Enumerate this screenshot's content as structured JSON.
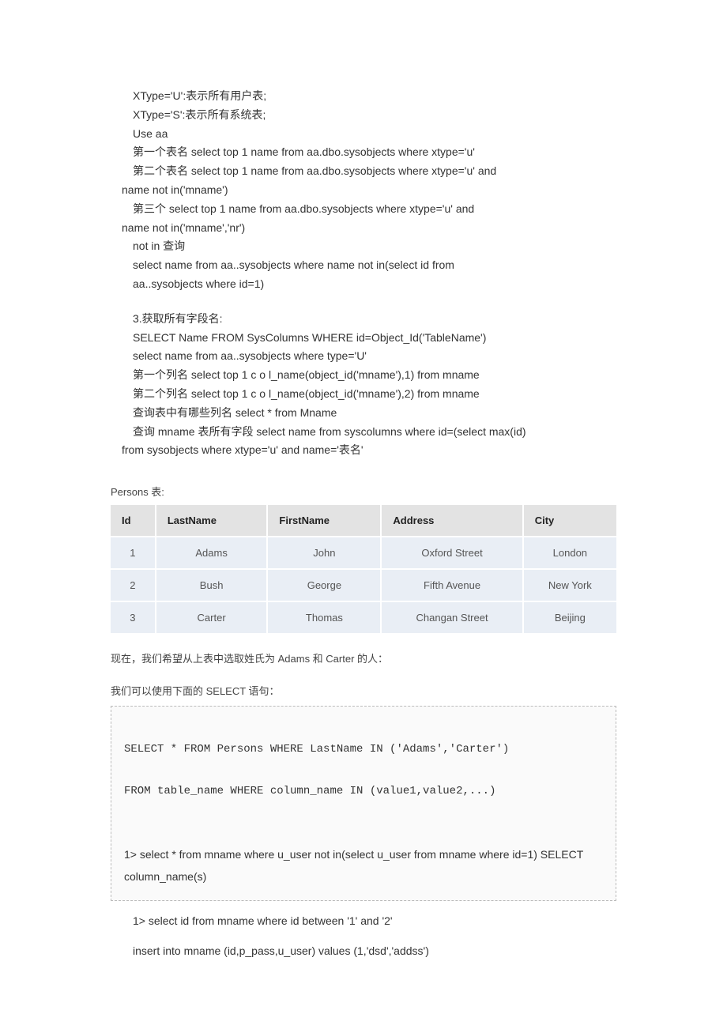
{
  "block1": {
    "l1": "XType='U':表示所有用户表;",
    "l2": "XType='S':表示所有系统表;",
    "l3": "Use aa",
    "l4": "第一个表名 select top 1 name from aa.dbo.sysobjects where xtype='u'",
    "l5a": "第二个表名 select top 1 name from aa.dbo.sysobjects where xtype='u' and",
    "l5b": "name not in('mname')",
    "l6a": "第三个 select top 1 name from aa.dbo.sysobjects where xtype='u' and",
    "l6b": "name not in('mname','nr')",
    "l7": "not in 查询",
    "l8": "select name from aa..sysobjects where name not in(select id from",
    "l9": "aa..sysobjects where id=1)"
  },
  "block2": {
    "l1": "3.获取所有字段名:",
    "l2": "SELECT Name FROM SysColumns WHERE id=Object_Id('TableName')",
    "l3": "select name from aa..sysobjects where type='U'",
    "l4": "第一个列名 select top 1   c o l_name(object_id('mname'),1) from mname",
    "l5": "第二个列名 select top 1   c o l_name(object_id('mname'),2) from mname",
    "l6": "查询表中有哪些列名 select * from Mname",
    "l7a": "查询 mname 表所有字段 select name from syscolumns where id=(select max(id)",
    "l7b": "from sysobjects where xtype='u' and name='表名'"
  },
  "caption": "Persons 表:",
  "table": {
    "headers": [
      "Id",
      "LastName",
      "FirstName",
      "Address",
      "City"
    ],
    "rows": [
      [
        "1",
        "Adams",
        "John",
        "Oxford Street",
        "London"
      ],
      [
        "2",
        "Bush",
        "George",
        "Fifth Avenue",
        "New York"
      ],
      [
        "3",
        "Carter",
        "Thomas",
        "Changan Street",
        "Beijing"
      ]
    ]
  },
  "note1": "现在，我们希望从上表中选取姓氏为 Adams 和 Carter 的人：",
  "note2": "我们可以使用下面的 SELECT 语句：",
  "codebox": {
    "l1": "SELECT * FROM Persons WHERE LastName IN ('Adams','Carter')",
    "l2": "FROM table_name WHERE column_name IN (value1,value2,...)",
    "l3": "1> select * from mname where u_user not in(select u_user from mname where id=1) SELECT column_name(s)"
  },
  "after": {
    "l1": "1> select id from mname where id   between '1' and '2'",
    "l2": "insert into mname (id,p_pass,u_user) values (1,'dsd','addss')"
  }
}
